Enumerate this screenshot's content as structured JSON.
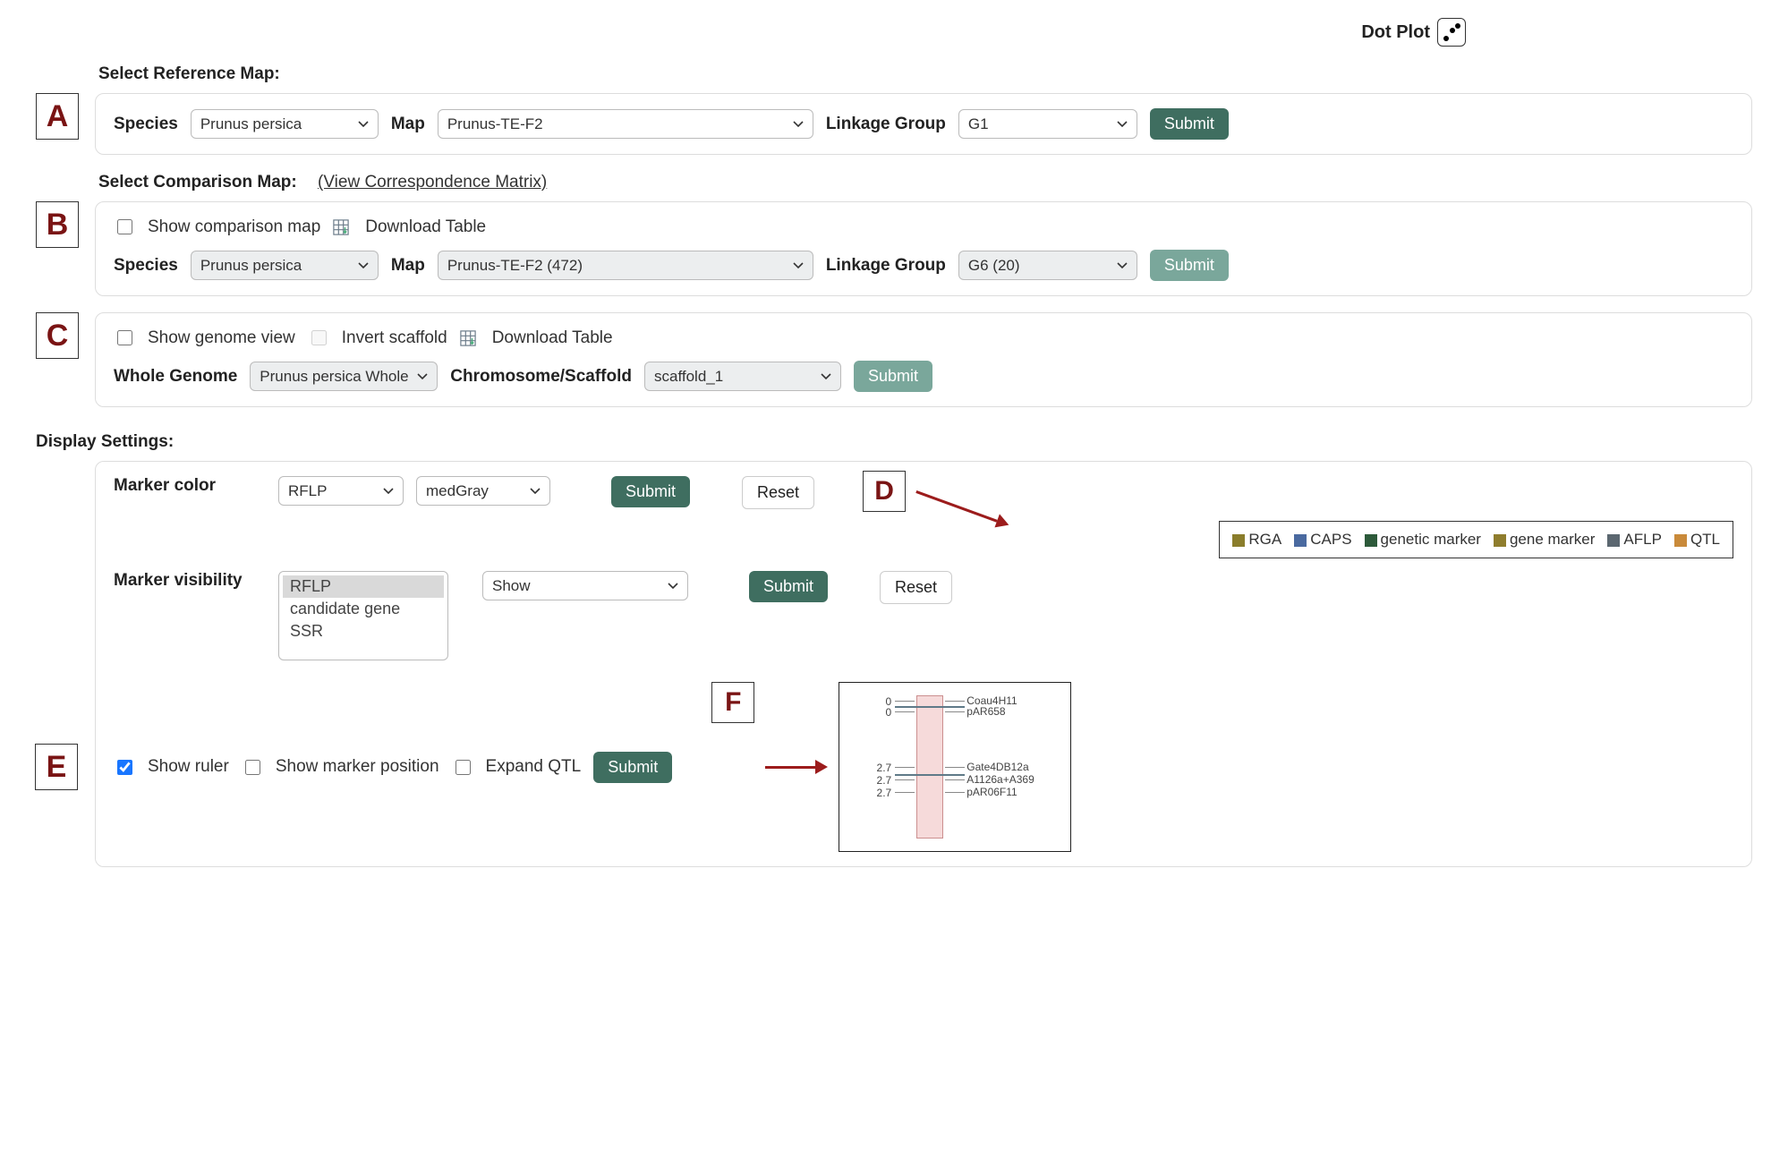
{
  "topRight": {
    "label": "Dot Plot"
  },
  "sections": {
    "reference": {
      "title": "Select Reference Map:",
      "speciesLabel": "Species",
      "species": "Prunus persica",
      "mapLabel": "Map",
      "map": "Prunus-TE-F2",
      "lgLabel": "Linkage Group",
      "lg": "G1",
      "submit": "Submit"
    },
    "comparison": {
      "title": "Select Comparison Map:",
      "matrixLink": "(View Correspondence Matrix)",
      "showCmp": "Show comparison map",
      "download": "Download Table",
      "speciesLabel": "Species",
      "species": "Prunus persica",
      "mapLabel": "Map",
      "map": "Prunus-TE-F2 (472)",
      "lgLabel": "Linkage Group",
      "lg": "G6 (20)",
      "submit": "Submit"
    },
    "genome": {
      "showGenome": "Show genome view",
      "invert": "Invert scaffold",
      "download": "Download Table",
      "wgLabel": "Whole Genome",
      "wg": "Prunus persica Whole",
      "csLabel": "Chromosome/Scaffold",
      "cs": "scaffold_1",
      "submit": "Submit"
    },
    "display": {
      "title": "Display Settings:",
      "markerColorLabel": "Marker color",
      "markerType": "RFLP",
      "color": "medGray",
      "submit": "Submit",
      "reset": "Reset",
      "markerVisLabel": "Marker visibility",
      "visItems": [
        "RFLP",
        "candidate gene",
        "SSR"
      ],
      "visMode": "Show",
      "showRuler": "Show ruler",
      "showPos": "Show marker position",
      "expandQTL": "Expand QTL"
    }
  },
  "legend": {
    "items": [
      {
        "name": "RGA",
        "color": "#8a7d2b"
      },
      {
        "name": "CAPS",
        "color": "#4a6aa0"
      },
      {
        "name": "genetic marker",
        "color": "#2d5a3a"
      },
      {
        "name": "gene marker",
        "color": "#8f7d2d"
      },
      {
        "name": "AFLP",
        "color": "#5b6770"
      },
      {
        "name": "QTL",
        "color": "#c98a3a"
      }
    ]
  },
  "diagram": {
    "markers": [
      {
        "pos": "0",
        "name": "Coau4H11"
      },
      {
        "pos": "0",
        "name": "pAR658"
      },
      {
        "pos": "2.7",
        "name": "Gate4DB12a"
      },
      {
        "pos": "2.7",
        "name": "A1126a+A369"
      },
      {
        "pos": "2.7",
        "name": "pAR06F11"
      }
    ]
  },
  "letters": {
    "A": "A",
    "B": "B",
    "C": "C",
    "D": "D",
    "E": "E",
    "F": "F"
  }
}
